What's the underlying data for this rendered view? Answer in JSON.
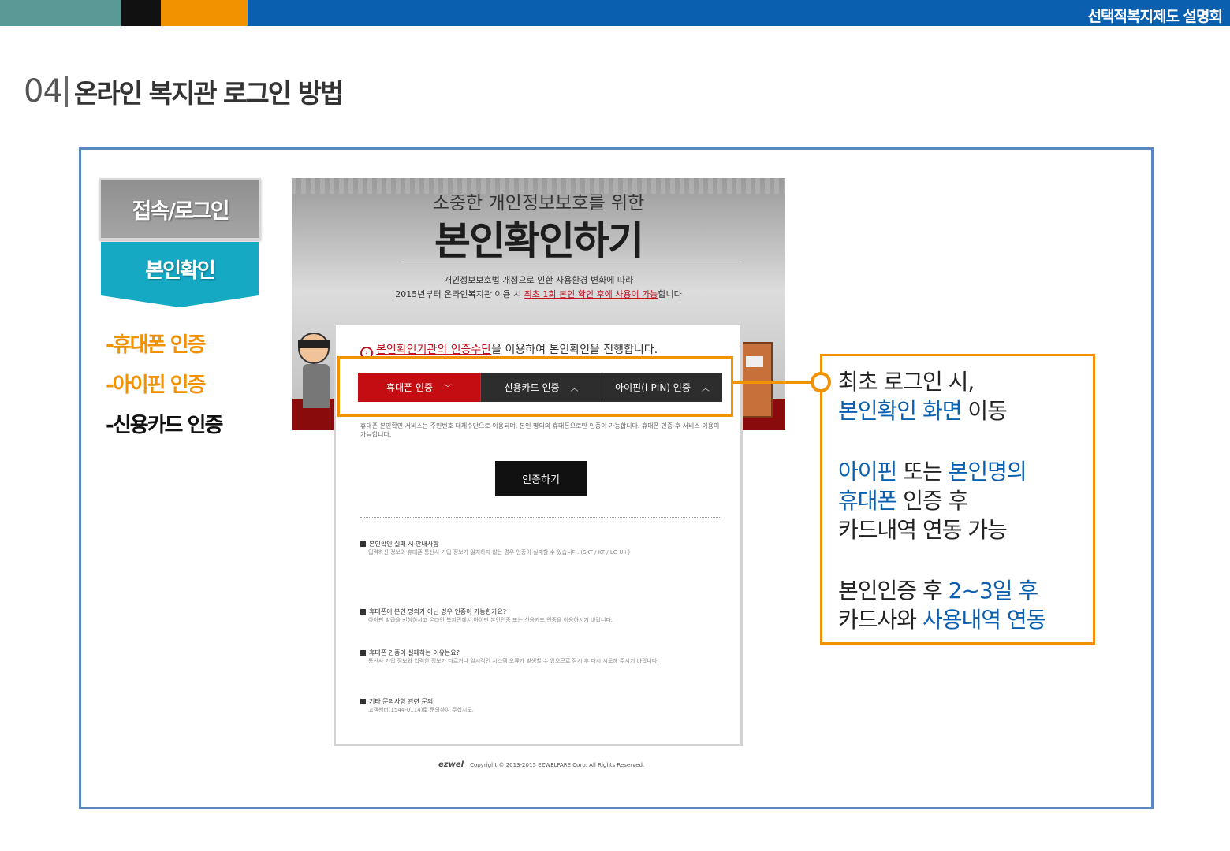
{
  "header": {
    "brand": "선택적복지제도 설명회",
    "section_number": "04",
    "title": "온라인 복지관 로그인 방법"
  },
  "steps": [
    {
      "label": "접속/로그인"
    },
    {
      "label": "본인확인"
    }
  ],
  "methods": [
    {
      "label": "-휴대폰 인증",
      "color": "#f39200"
    },
    {
      "label": "-아이핀 인증",
      "color": "#f39200"
    },
    {
      "label": "-신용카드 인증",
      "color": "#111111"
    }
  ],
  "screen": {
    "subtitle": "소중한 개인정보보호를 위한",
    "title": "본인확인하기",
    "desc_line1": "개인정보보호법 개정으로 인한 사용환경 변화에 따라",
    "desc_line2_prefix": "2015년부터 온라인복지관 이용 시 ",
    "desc_line2_highlight": "최초 1회 본인 확인 후에 사용이 가능",
    "desc_line2_suffix": "합니다",
    "intro_prefix": "본인확인기관의 인증수단",
    "intro_suffix": "을 이용하여 본인확인을 진행합니다.",
    "tabs": [
      {
        "label": "휴대폰 인증",
        "active": true
      },
      {
        "label": "신용카드 인증",
        "active": false
      },
      {
        "label": "아이핀(i-PIN) 인증",
        "active": false
      }
    ],
    "notice": "휴대폰 본인확인 서비스는 주민번호 대체수단으로 이용되며, 본인 명의의 휴대폰으로만 인증이 가능합니다. 휴대폰 인증 후 서비스 이용이 가능합니다.",
    "confirm_button": "인증하기",
    "faq": [
      {
        "q": "본인확인 실패 시 안내사항",
        "a": "입력하신 정보와 휴대폰 통신사 가입 정보가 일치하지 않는 경우 인증이 실패할 수 있습니다. (SKT / KT / LG U+)"
      },
      {
        "q": "휴대폰이 본인 명의가 아닌 경우 인증이 가능한가요?",
        "a": "아이핀 발급을 신청하시고 온라인 복지관에서 아이핀 본인인증 또는 신용카드 인증을 이용하시기 바랍니다."
      },
      {
        "q": "휴대폰 인증이 실패하는 이유는요?",
        "a": "통신사 가입 정보와 입력한 정보가 다르거나 일시적인 시스템 오류가 발생할 수 있으므로 잠시 후 다시 시도해 주시기 바랍니다."
      },
      {
        "q": "기타 문의사항 관련 문의",
        "a": "고객센터(1544-0114)로 문의하여 주십시오."
      }
    ],
    "footer_logo": "ezwel",
    "footer_copy": "Copyright © 2013-2015 EZWELFARE Corp. All Rights Reserved."
  },
  "callout": {
    "line1": "최초 로그인 시,",
    "line2_blue": "본인확인 화면",
    "line2_rest": " 이동",
    "line3_blue1": "아이핀",
    "line3_mid": " 또는 ",
    "line3_blue2": "본인명의",
    "line4_blue": "휴대폰",
    "line4_rest": " 인증 후",
    "line5": "카드내역 연동 가능",
    "line6_prefix": "본인인증 후 ",
    "line6_blue": "2~3일 후",
    "line7_prefix": "카드사와 ",
    "line7_blue": "사용내역 연동"
  },
  "colors": {
    "accent_orange": "#f39200",
    "brand_blue": "#0a5fae",
    "teal": "#15a9c4",
    "tab_red": "#c40d12"
  }
}
